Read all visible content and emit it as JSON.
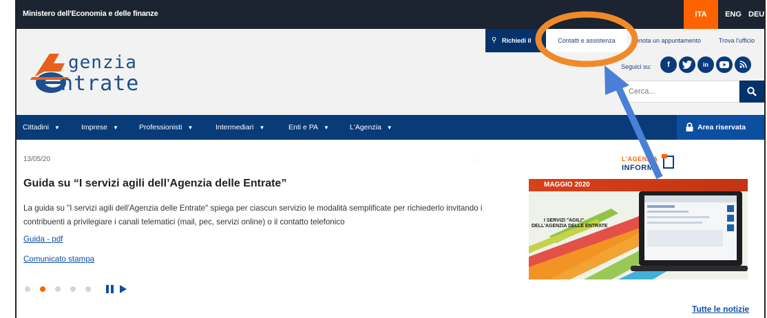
{
  "topbar": {
    "ministry": "Ministero dell'Economia e delle finanze",
    "languages": [
      "ITA",
      "ENG",
      "DEU"
    ],
    "active_language": "ITA"
  },
  "header": {
    "logo_line1": "genzia",
    "logo_line2": "ntrate",
    "service_links": {
      "richiedi": "Richiedi il",
      "contatti": "Contatti e assistenza",
      "prenota": "enota un appuntamento",
      "trova": "Trova l'ufficio"
    },
    "social_label": "Seguici su:",
    "social_icons": [
      "facebook-icon",
      "twitter-icon",
      "linkedin-icon",
      "youtube-icon",
      "rss-icon"
    ],
    "search_placeholder": "Cerca..."
  },
  "nav": {
    "items": [
      "Cittadini",
      "Imprese",
      "Professionisti",
      "Intermediari",
      "Enti e PA",
      "L'Agenzia"
    ],
    "reserved_area": "Area riservata"
  },
  "content": {
    "date": "13/05/20",
    "title": "Guida su “I servizi agili dell’Agenzia delle Entrate”",
    "description": "La guida su \"I servizi agili dell'Agenzia delle Entrate\" spiega per ciascun servizio le modalità semplificate per richiederlo invitando i contribuenti a privilegiare i canali telematici (mail, pec, servizi online) o il contatto telefonico",
    "link1": "Guida - pdf",
    "link2": "Comunicato stampa",
    "marker": "·",
    "carousel_dots": 5,
    "carousel_active": 1,
    "all_news": "Tutte le notizie"
  },
  "promo": {
    "logo_line1": "L'AGENZIA",
    "logo_line2": "INFORMA",
    "band": "MAGGIO 2020",
    "tag1": "I SERVIZI \"AGILI\"",
    "tag2": "DELL'AGENZIA DELLE ENTRATE"
  },
  "colors": {
    "topbar": "#1c2431",
    "accent_orange": "#ff6300",
    "nav_blue": "#083b78",
    "reserved_blue": "#0c4fa0",
    "annotation_orange": "#f08a28",
    "annotation_arrow": "#4a7fd6"
  }
}
